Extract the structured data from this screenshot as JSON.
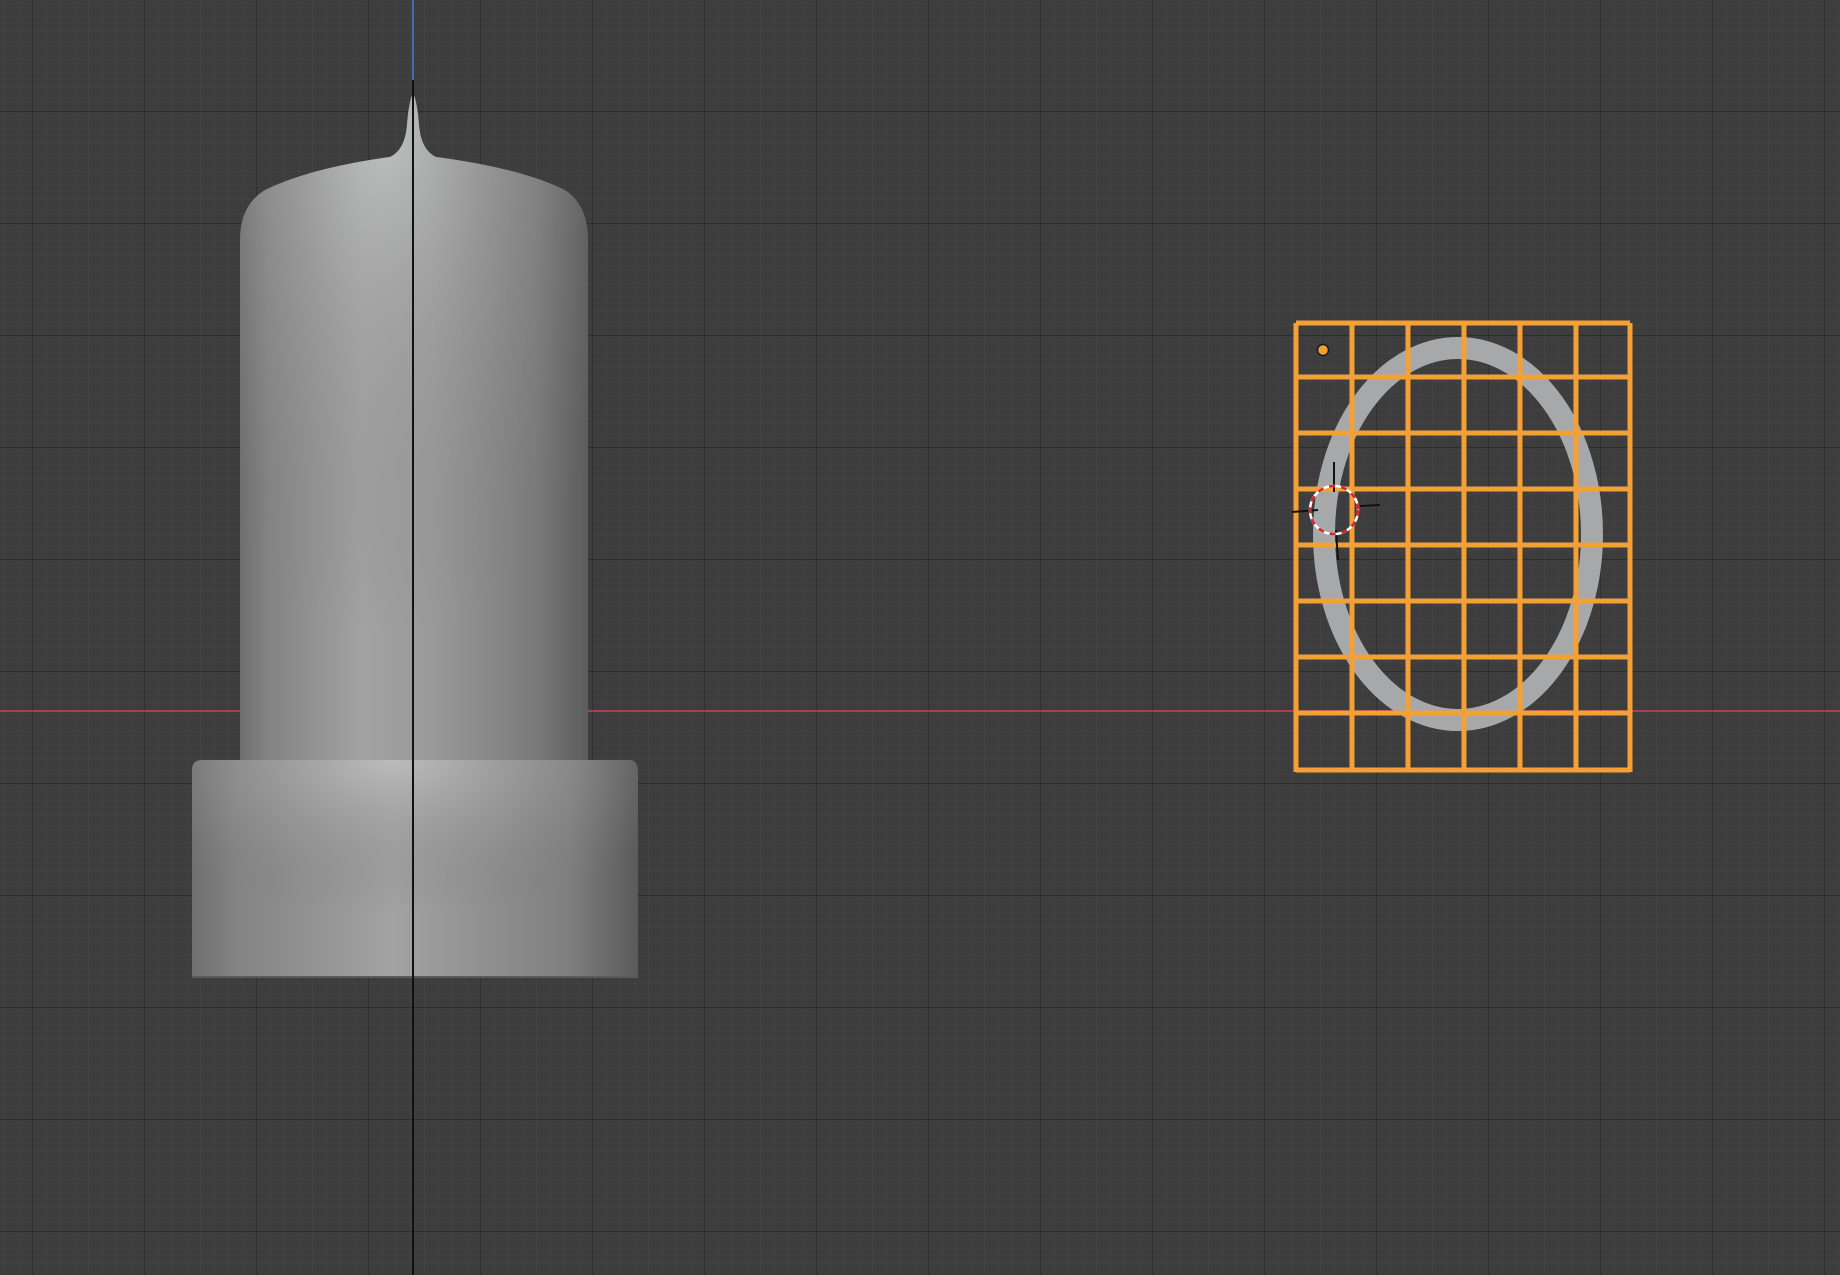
{
  "viewport": {
    "background_color": "#3d3d3d",
    "axis_x_color": "#c8444f",
    "axis_z_color": "#4a7ccf"
  },
  "objects": {
    "vacuum_tube": {
      "icon": "vacuum-tube-mesh",
      "color": "#8f8f8f"
    },
    "lattice": {
      "icon": "lattice-cage",
      "color": "#f5a035",
      "divisions_u": 6,
      "divisions_v": 8
    },
    "torus": {
      "icon": "ring-mesh",
      "color": "#a6a8aa"
    }
  },
  "cursor": {
    "icon": "3d-cursor-icon",
    "colors": [
      "#d8242b",
      "#ffffff"
    ]
  }
}
